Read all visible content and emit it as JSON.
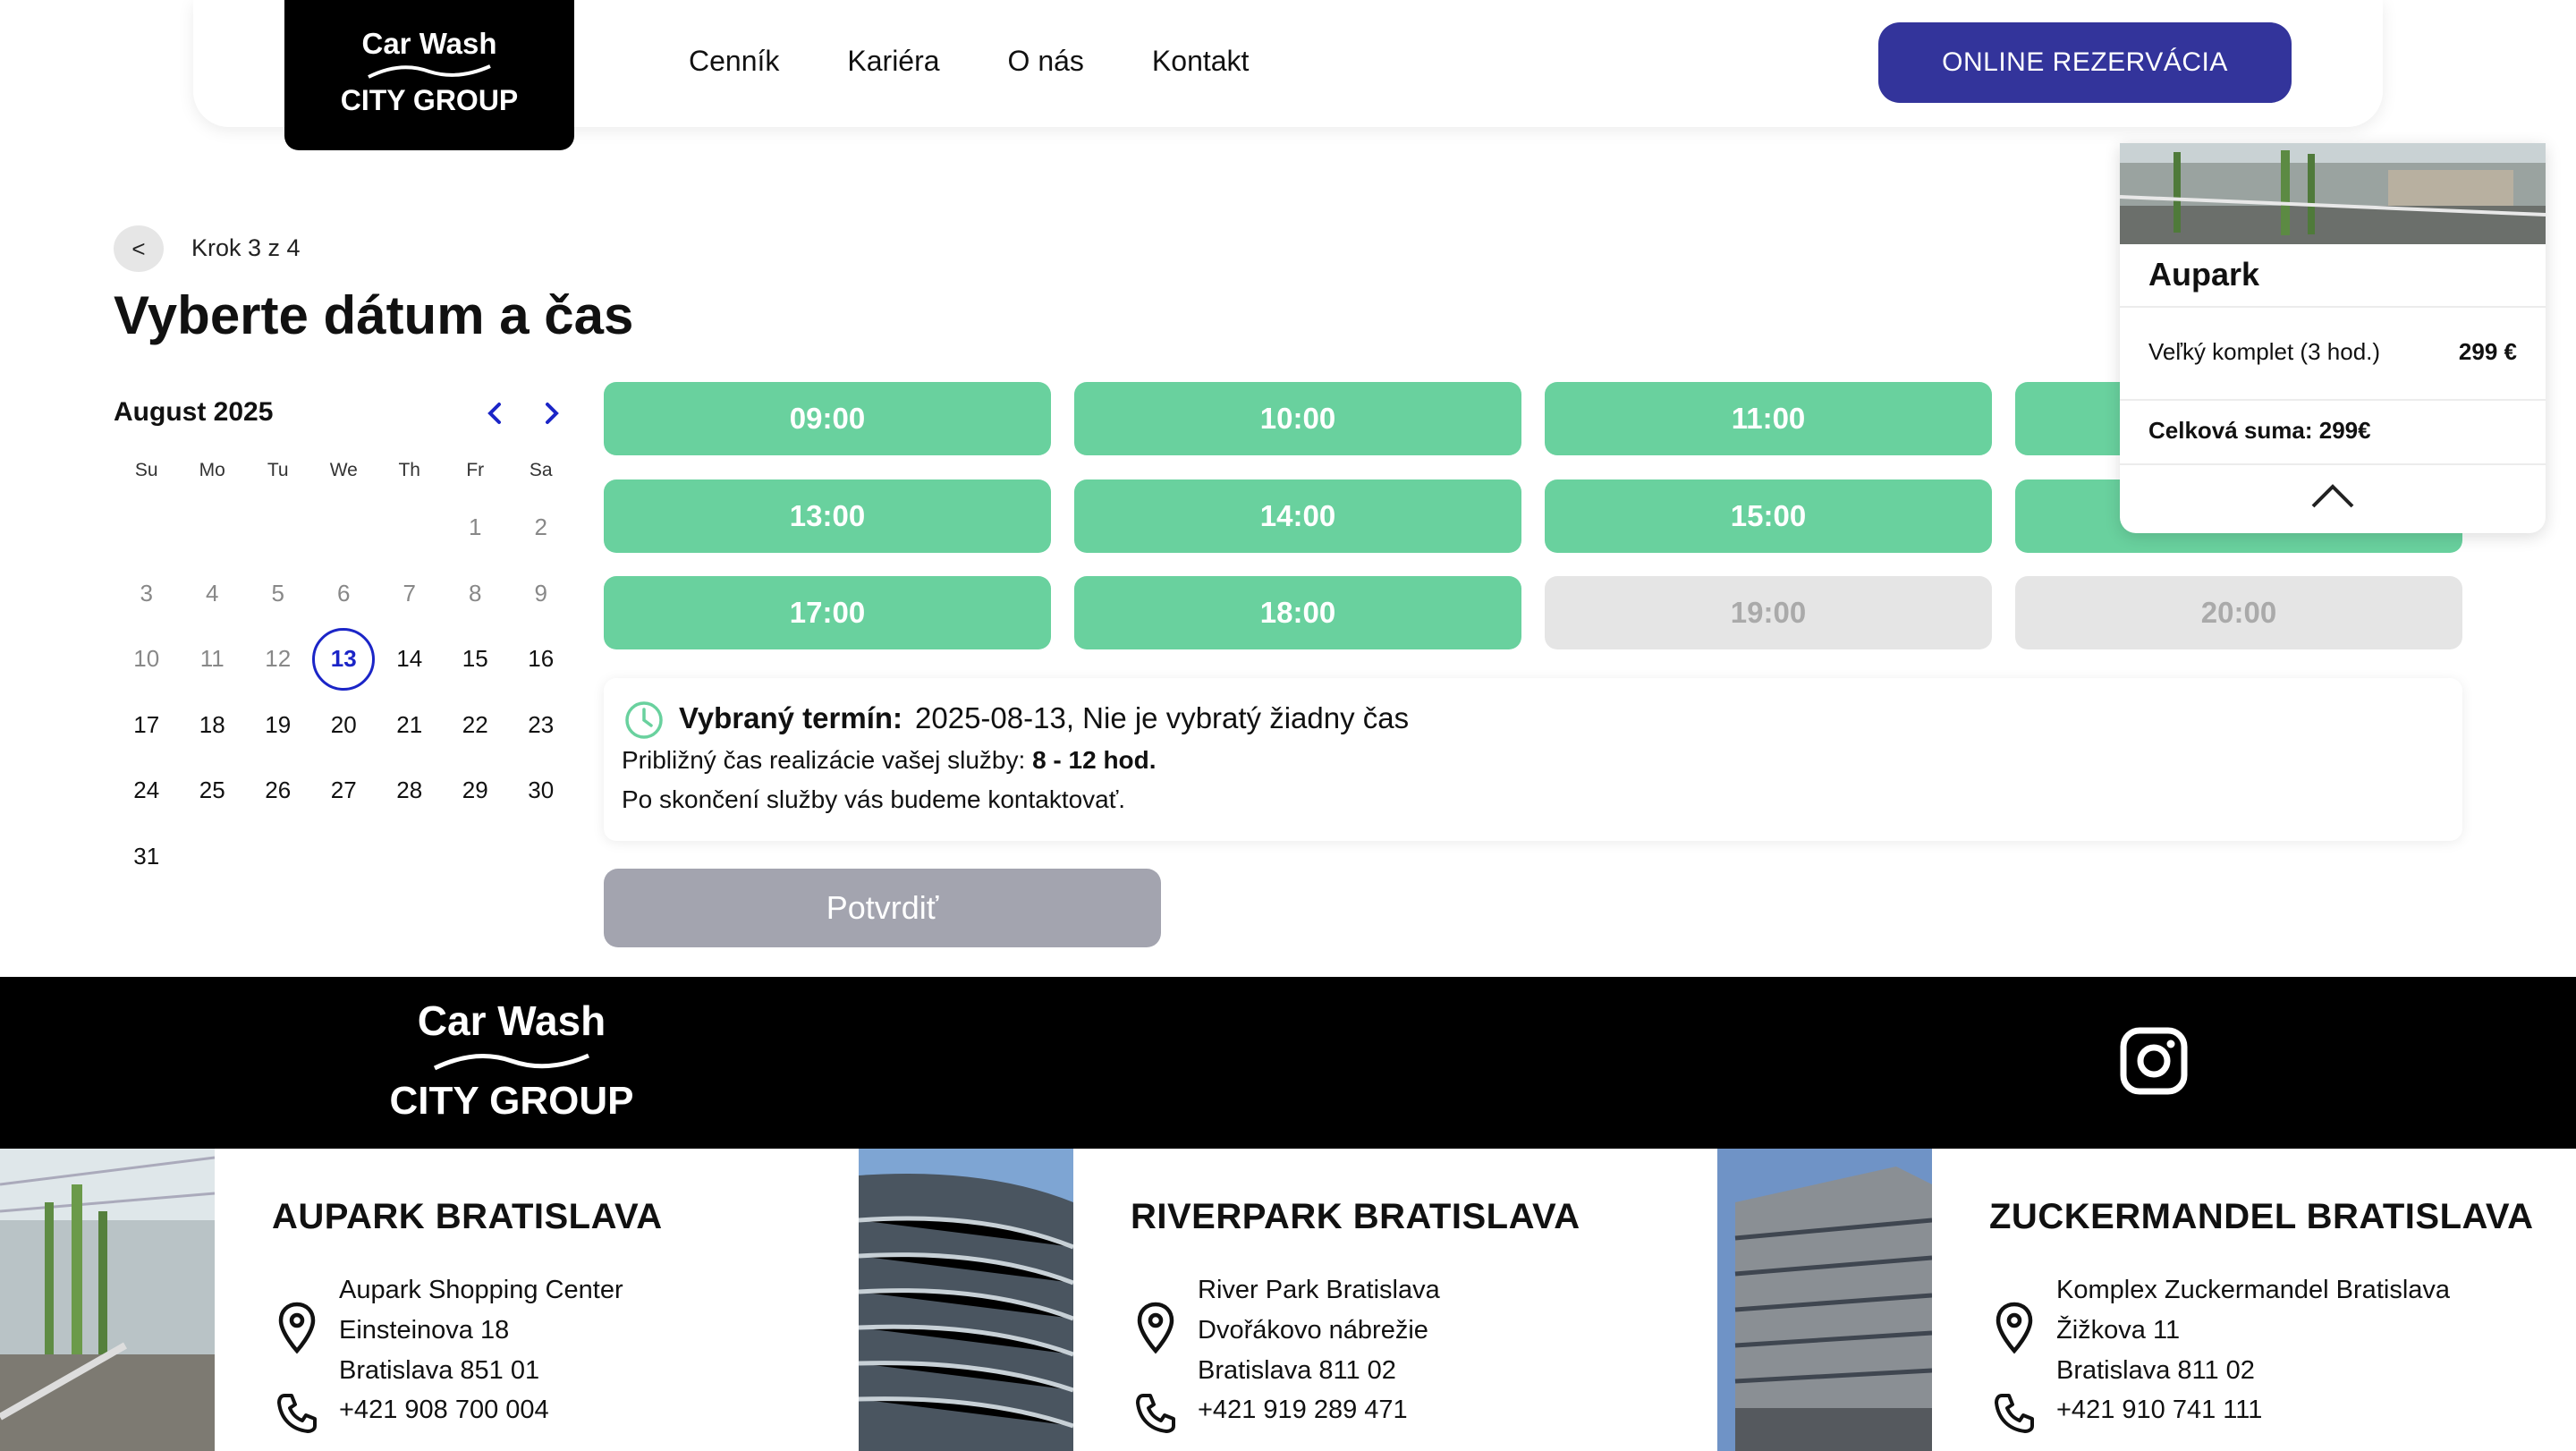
{
  "header": {
    "logo": {
      "line1": "Car Wash",
      "line2": "CITY GROUP"
    },
    "nav": [
      "Cenník",
      "Kariéra",
      "O nás",
      "Kontakt"
    ],
    "cta": "ONLINE REZERVÁCIA"
  },
  "step": {
    "back": "<",
    "label": "Krok 3 z 4"
  },
  "title": "Vyberte dátum a čas",
  "calendar": {
    "month": "August 2025",
    "weekdays": [
      "Su",
      "Mo",
      "Tu",
      "We",
      "Th",
      "Fr",
      "Sa"
    ],
    "days": [
      "",
      "",
      "",
      "",
      "",
      "1",
      "2",
      "3",
      "4",
      "5",
      "6",
      "7",
      "8",
      "9",
      "10",
      "11",
      "12",
      "13",
      "14",
      "15",
      "16",
      "17",
      "18",
      "19",
      "20",
      "21",
      "22",
      "23",
      "24",
      "25",
      "26",
      "27",
      "28",
      "29",
      "30",
      "31"
    ],
    "selected": "13"
  },
  "slots": [
    {
      "time": "09:00",
      "available": true
    },
    {
      "time": "10:00",
      "available": true
    },
    {
      "time": "11:00",
      "available": true
    },
    {
      "time": "13:00",
      "available": true
    },
    {
      "time": "14:00",
      "available": true
    },
    {
      "time": "15:00",
      "available": true
    },
    {
      "time": "17:00",
      "available": true
    },
    {
      "time": "18:00",
      "available": true
    },
    {
      "time": "19:00",
      "available": false
    },
    {
      "time": "20:00",
      "available": false
    }
  ],
  "info": {
    "selected_label": "Vybraný termín:",
    "selected_value": "2025-08-13, Nie je vybratý žiadny čas",
    "duration_prefix": "Približný čas realizácie vašej služby: ",
    "duration_value": "8 - 12 hod.",
    "note": "Po skončení služby vás budeme kontaktovať."
  },
  "confirm": "Potvrdiť",
  "summary": {
    "location": "Aupark",
    "service": "Veľký komplet (3 hod.)",
    "price": "299 €",
    "total": "Celková suma: 299€"
  },
  "footer": {
    "logo": {
      "line1": "Car Wash",
      "line2": "CITY GROUP"
    },
    "locations": [
      {
        "title": "AUPARK BRATISLAVA",
        "addr1": "Aupark Shopping Center",
        "addr2": "Einsteinova 18",
        "addr3": "Bratislava 851 01",
        "phone": "+421 908 700 004"
      },
      {
        "title": "RIVERPARK BRATISLAVA",
        "addr1": "River Park Bratislava",
        "addr2": "Dvořákovo nábrežie",
        "addr3": "Bratislava 811 02",
        "phone": "+421 919 289 471"
      },
      {
        "title": "ZUCKERMANDEL BRATISLAVA",
        "addr1": "Komplex Zuckermandel Bratislava",
        "addr2": "Žižkova 11",
        "addr3": "Bratislava 811 02",
        "phone": "+421 910 741 111"
      }
    ]
  },
  "colors": {
    "accent": "#33349b",
    "slot_free": "#69d19e",
    "slot_off": "#e5e5e5",
    "selected_day": "#1b25c7"
  }
}
